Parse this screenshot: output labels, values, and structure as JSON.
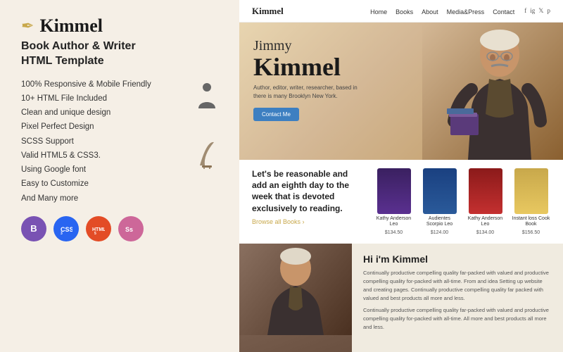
{
  "brand": {
    "name": "Kimmel",
    "icon": "✒",
    "tagline": "Book Author & Writer\nHTML Template"
  },
  "features": [
    "100% Responsive & Mobile Friendly",
    "10+ HTML File Included",
    "Clean and unique design",
    "Pixel Perfect Design",
    "SCSS Support",
    "Valid HTML5 & CSS3.",
    "Using Google font",
    "Easy to Customize",
    "And Many more"
  ],
  "navbar": {
    "brand": "Kimmel",
    "links": [
      "Home",
      "Books",
      "About",
      "Media&Press",
      "Contact"
    ],
    "social": [
      "f",
      "ig",
      "𝕏",
      "p"
    ]
  },
  "hero": {
    "name_first": "Jimmy",
    "name_last": "Kimmel",
    "description": "Author, editor, writer, researcher, based in\nthere is many Brooklyn New York.",
    "cta_button": "Contact Me"
  },
  "books_section": {
    "quote": "Let's be reasonable and add an eighth day to the week that is devoted exclusively to reading.",
    "browse_link": "Browse all Books ›",
    "books": [
      {
        "title": "Kathy Anderson Leo",
        "price": "$134.50",
        "color": "purple"
      },
      {
        "title": "Audientes Scorpio Leo",
        "price": "$124.00",
        "color": "blue"
      },
      {
        "title": "Kathy Anderson Leo",
        "price": "$134.00",
        "color": "red"
      },
      {
        "title": "Instant loss Cook Book",
        "price": "$156.50",
        "color": "gold"
      }
    ]
  },
  "about": {
    "title": "Hi i'm Kimmel",
    "paragraph1": "Continually productive compelling quality far-packed with valued and productive compelling quality for-packed with all-time. From and idea Setting up website and creating pages. Continually productive compelling quality far packed with valued and best products all more and less.",
    "paragraph2": "Continually productive compelling quality far-packed with valued and productive compelling quality for-packed with all-time. All more and best products all more and less."
  },
  "badges": [
    {
      "label": "B",
      "type": "bootstrap",
      "title": "Bootstrap"
    },
    {
      "label": "CSS3",
      "type": "css3",
      "title": "CSS3"
    },
    {
      "label": "HTML5",
      "type": "html5",
      "title": "HTML5"
    },
    {
      "label": "Sass",
      "type": "sass",
      "title": "Sass"
    }
  ]
}
